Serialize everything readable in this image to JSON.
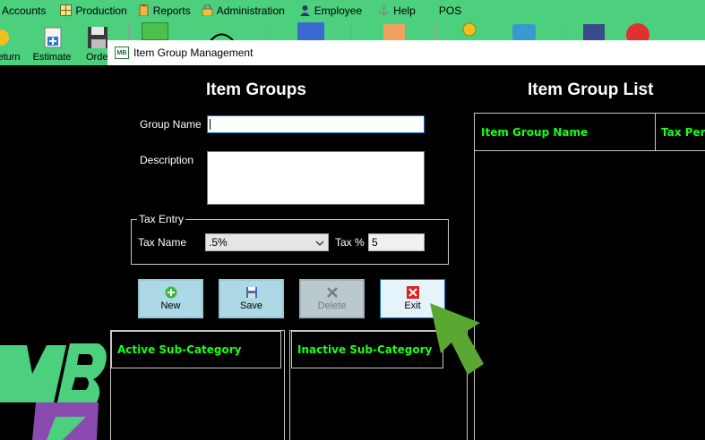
{
  "menubar": {
    "items": [
      {
        "label": "Accounts",
        "icon": "accounts-icon"
      },
      {
        "label": "Production",
        "icon": "grid-icon"
      },
      {
        "label": "Reports",
        "icon": "clipboard-icon"
      },
      {
        "label": "Administration",
        "icon": "lock-icon"
      },
      {
        "label": "Employee",
        "icon": "person-icon"
      },
      {
        "label": "Help",
        "icon": "anchor-icon"
      },
      {
        "label": "POS",
        "icon": ""
      }
    ]
  },
  "toolbar": {
    "items": [
      {
        "label": "eturn"
      },
      {
        "label": "Estimate"
      },
      {
        "label": "Orde"
      }
    ]
  },
  "window": {
    "title": "Item Group Management",
    "app_icon_text": "MB"
  },
  "form": {
    "heading": "Item Groups",
    "group_name_label": "Group Name",
    "group_name_value": "",
    "description_label": "Description",
    "description_value": "",
    "tax_entry_legend": "Tax Entry",
    "tax_name_label": "Tax Name",
    "tax_name_selected": ".5%",
    "tax_percent_label": "Tax %",
    "tax_percent_value": "5"
  },
  "actions": {
    "new_label": "New",
    "save_label": "Save",
    "delete_label": "Delete",
    "exit_label": "Exit"
  },
  "subcategories": {
    "active_header": "Active Sub-Category",
    "inactive_header": "Inactive Sub-Category"
  },
  "list": {
    "heading": "Item Group List",
    "columns": [
      "Item Group Name",
      "Tax Perce"
    ]
  },
  "logo": {
    "text": "MB"
  },
  "colors": {
    "app_green": "#4cd07d",
    "grid_header_text": "#19ff19",
    "button_blue": "#add8e6",
    "arrow_green": "#5aa832"
  }
}
